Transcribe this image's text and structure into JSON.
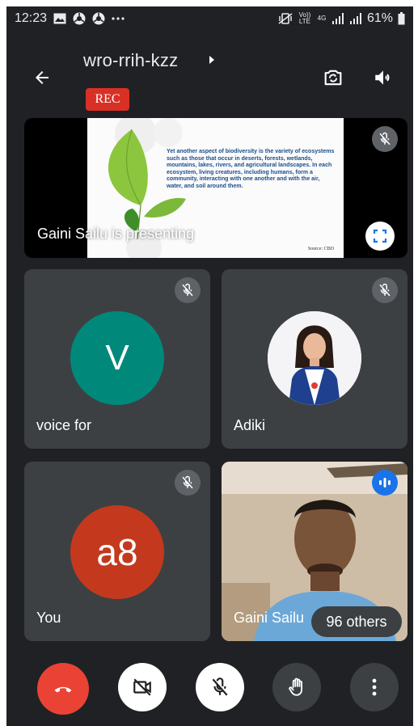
{
  "status_bar": {
    "time": "12:23",
    "volte_label": "Vo)) LTE",
    "network_label": "4G",
    "battery_percent": "61%"
  },
  "header": {
    "meeting_code": "wro-rrih-kzz",
    "rec_label": "REC"
  },
  "presentation": {
    "label": "Gaini Sailu is presenting",
    "slide_text": "Yet another aspect of biodiversity is the variety of ecosystems such as those that occur in deserts, forests, wetlands, mountains, lakes, rivers, and agricultural landscapes. In each ecosystem, living creatures, including humans, form a community, interacting with one another and with the air, water, and soil around them.",
    "slide_source": "Source: CBD"
  },
  "tiles": [
    {
      "name": "voice for",
      "initials": "V",
      "avatar_color": "#00897b",
      "muted": true
    },
    {
      "name": "Adiki",
      "muted": true
    },
    {
      "name": "You",
      "initials": "a8",
      "avatar_color": "#c4391d",
      "muted": true
    },
    {
      "name": "Gaini Sailu",
      "speaking": true
    }
  ],
  "others_label": "96 others",
  "colors": {
    "background": "#202124",
    "tile": "#3c4043",
    "end_call": "#ea4335",
    "rec": "#d93025",
    "speaking": "#1a73e8"
  }
}
